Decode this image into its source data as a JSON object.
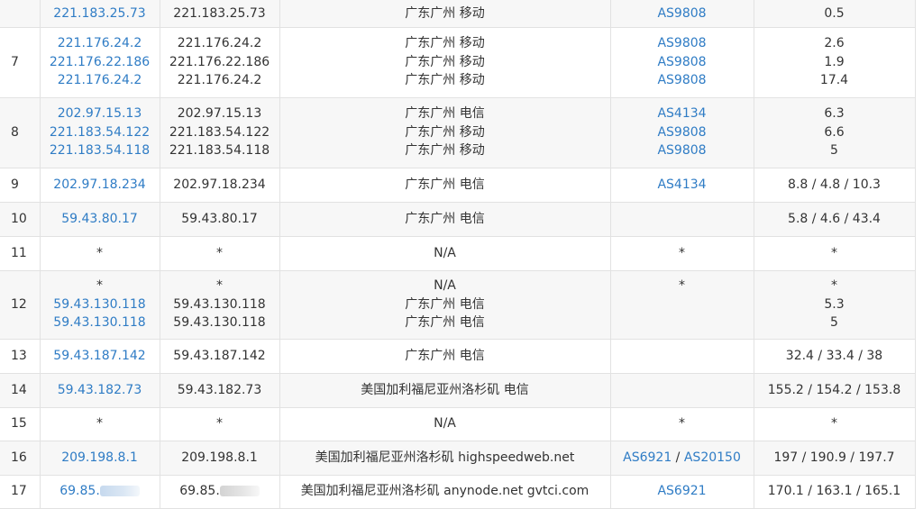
{
  "hops": [
    {
      "hop": "",
      "ips": [
        "221.183.25.73"
      ],
      "hosts": [
        "221.183.25.73"
      ],
      "locs": [
        "广东广州 移动"
      ],
      "as": [
        [
          "AS9808"
        ]
      ],
      "times": [
        "0.5"
      ]
    },
    {
      "hop": "7",
      "ips": [
        "221.176.24.2",
        "221.176.22.186",
        "221.176.24.2"
      ],
      "hosts": [
        "221.176.24.2",
        "221.176.22.186",
        "221.176.24.2"
      ],
      "locs": [
        "广东广州 移动",
        "广东广州 移动",
        "广东广州 移动"
      ],
      "as": [
        [
          "AS9808"
        ],
        [
          "AS9808"
        ],
        [
          "AS9808"
        ]
      ],
      "times": [
        "2.6",
        "1.9",
        "17.4"
      ]
    },
    {
      "hop": "8",
      "ips": [
        "202.97.15.13",
        "221.183.54.122",
        "221.183.54.118"
      ],
      "hosts": [
        "202.97.15.13",
        "221.183.54.122",
        "221.183.54.118"
      ],
      "locs": [
        "广东广州 电信",
        "广东广州 移动",
        "广东广州 移动"
      ],
      "as": [
        [
          "AS4134"
        ],
        [
          "AS9808"
        ],
        [
          "AS9808"
        ]
      ],
      "times": [
        "6.3",
        "6.6",
        "5"
      ]
    },
    {
      "hop": "9",
      "ips": [
        "202.97.18.234"
      ],
      "hosts": [
        "202.97.18.234"
      ],
      "locs": [
        "广东广州 电信"
      ],
      "as": [
        [
          "AS4134"
        ]
      ],
      "times": [
        "8.8 / 4.8 / 10.3"
      ]
    },
    {
      "hop": "10",
      "ips": [
        "59.43.80.17"
      ],
      "hosts": [
        "59.43.80.17"
      ],
      "locs": [
        "广东广州 电信"
      ],
      "as": [
        []
      ],
      "times": [
        "5.8 / 4.6 / 43.4"
      ]
    },
    {
      "hop": "11",
      "ips": [
        "*"
      ],
      "hosts": [
        "*"
      ],
      "locs": [
        "N/A"
      ],
      "as": [
        [
          "*"
        ]
      ],
      "times": [
        "*"
      ]
    },
    {
      "hop": "12",
      "ips": [
        "*",
        "59.43.130.118",
        "59.43.130.118"
      ],
      "hosts": [
        "*",
        "59.43.130.118",
        "59.43.130.118"
      ],
      "locs": [
        "N/A",
        "广东广州 电信",
        "广东广州 电信"
      ],
      "as": [
        [
          "*"
        ],
        [],
        []
      ],
      "times": [
        "*",
        "5.3",
        "5"
      ]
    },
    {
      "hop": "13",
      "ips": [
        "59.43.187.142"
      ],
      "hosts": [
        "59.43.187.142"
      ],
      "locs": [
        "广东广州 电信"
      ],
      "as": [
        []
      ],
      "times": [
        "32.4 / 33.4 / 38"
      ]
    },
    {
      "hop": "14",
      "ips": [
        "59.43.182.73"
      ],
      "hosts": [
        "59.43.182.73"
      ],
      "locs": [
        "美国加利福尼亚州洛杉矶 电信"
      ],
      "as": [
        []
      ],
      "times": [
        "155.2 / 154.2 / 153.8"
      ]
    },
    {
      "hop": "15",
      "ips": [
        "*"
      ],
      "hosts": [
        "*"
      ],
      "locs": [
        "N/A"
      ],
      "as": [
        [
          "*"
        ]
      ],
      "times": [
        "*"
      ]
    },
    {
      "hop": "16",
      "ips": [
        "209.198.8.1"
      ],
      "hosts": [
        "209.198.8.1"
      ],
      "locs": [
        "美国加利福尼亚州洛杉矶 highspeedweb.net"
      ],
      "as": [
        [
          "AS6921",
          "AS20150"
        ]
      ],
      "times": [
        "197 / 190.9 / 197.7"
      ]
    },
    {
      "hop": "17",
      "ips": [
        "69.85."
      ],
      "hosts": [
        "69.85."
      ],
      "locs": [
        "美国加利福尼亚州洛杉矶 anynode.net gvtci.com"
      ],
      "as": [
        [
          "AS6921"
        ]
      ],
      "times": [
        "170.1 / 163.1 / 165.1"
      ]
    }
  ],
  "redacted_last_hop": true,
  "colors": {
    "link": "#2f7cc5",
    "text": "#333333",
    "row_alt": "#f7f7f7",
    "border": "#e2e2e2"
  }
}
